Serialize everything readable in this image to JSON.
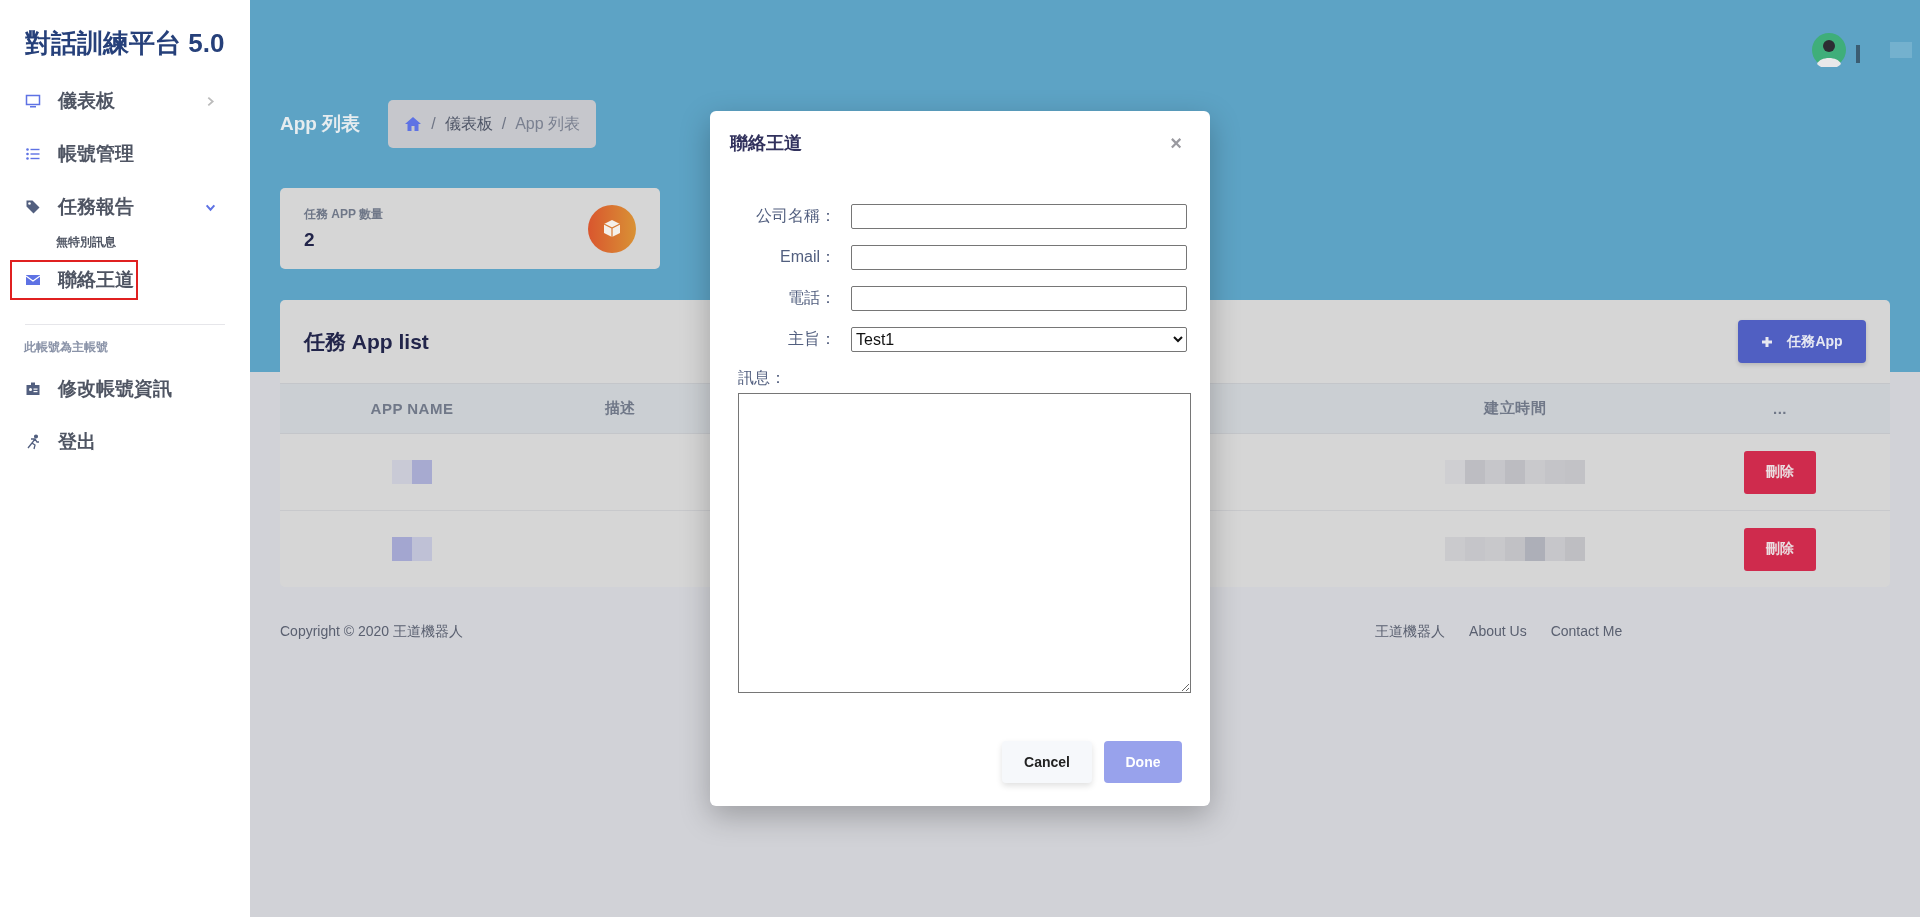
{
  "sidebar": {
    "title": "對話訓練平台 5.0",
    "items": [
      {
        "label": "儀表板",
        "expanded": false,
        "highlighted": false
      },
      {
        "label": "帳號管理",
        "highlighted": false
      },
      {
        "label": "任務報告",
        "expanded": true,
        "highlighted": false,
        "children": [
          {
            "label": "無特別訊息"
          }
        ]
      },
      {
        "label": "聯絡王道",
        "highlighted": true
      }
    ],
    "account_note": "此帳號為主帳號",
    "account_items": [
      {
        "label": "修改帳號資訊"
      },
      {
        "label": "登出"
      }
    ]
  },
  "page_title": "App 列表",
  "breadcrumb": [
    {
      "separator": "/",
      "label": "儀表板"
    },
    {
      "separator": "/",
      "label": "App 列表"
    }
  ],
  "stat_card": {
    "label": "任務 APP 數量",
    "value": "2"
  },
  "table": {
    "title": "任務 App list",
    "add_button": "任務App",
    "columns": [
      "APP NAME",
      "描述",
      "建立時間",
      "..."
    ],
    "rows": [
      {
        "delete_label": "刪除"
      },
      {
        "delete_label": "刪除"
      }
    ]
  },
  "footer": {
    "copyright": "Copyright © 2020 王道機器人",
    "links": [
      "王道機器人",
      "About Us",
      "Contact Me"
    ]
  },
  "modal": {
    "title": "聯絡王道",
    "close": "×",
    "fields": [
      {
        "label": "公司名稱：",
        "kind": "text"
      },
      {
        "label": "Email：",
        "kind": "text"
      },
      {
        "label": "電話：",
        "kind": "text"
      },
      {
        "label": "主旨：",
        "kind": "select",
        "value": "Test1"
      }
    ],
    "message_label": "訊息：",
    "buttons": [
      {
        "label": "Cancel",
        "kind": "secondary",
        "disabled": false
      },
      {
        "label": "Done",
        "kind": "primary",
        "disabled": true
      }
    ]
  }
}
